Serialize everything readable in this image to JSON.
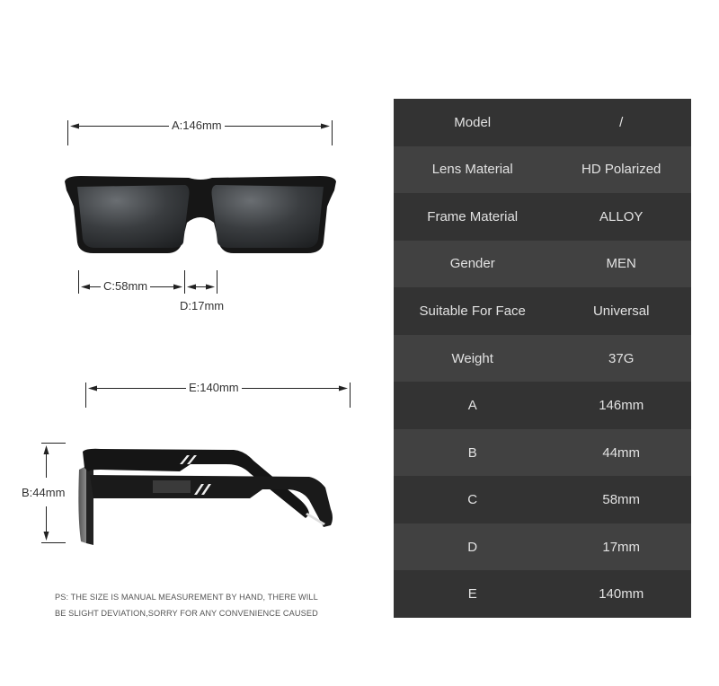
{
  "dimensions": {
    "a_label": "A:146mm",
    "c_label": "C:58mm",
    "d_label": "D:17mm",
    "e_label": "E:140mm",
    "b_label": "B:44mm"
  },
  "spec_table": {
    "rows": [
      {
        "label": "Model",
        "value": "/"
      },
      {
        "label": "Lens Material",
        "value": "HD Polarized"
      },
      {
        "label": "Frame Material",
        "value": "ALLOY"
      },
      {
        "label": "Gender",
        "value": "MEN"
      },
      {
        "label": "Suitable For Face",
        "value": "Universal"
      },
      {
        "label": "Weight",
        "value": "37G"
      },
      {
        "label": "A",
        "value": "146mm"
      },
      {
        "label": "B",
        "value": "44mm"
      },
      {
        "label": "C",
        "value": "58mm"
      },
      {
        "label": "D",
        "value": "17mm"
      },
      {
        "label": "E",
        "value": "140mm"
      }
    ]
  },
  "note": {
    "line1": "PS: THE SIZE IS MANUAL MEASUREMENT BY HAND, THERE WILL",
    "line2": "BE SLIGHT DEVIATION,SORRY FOR ANY CONVENIENCE CAUSED"
  }
}
